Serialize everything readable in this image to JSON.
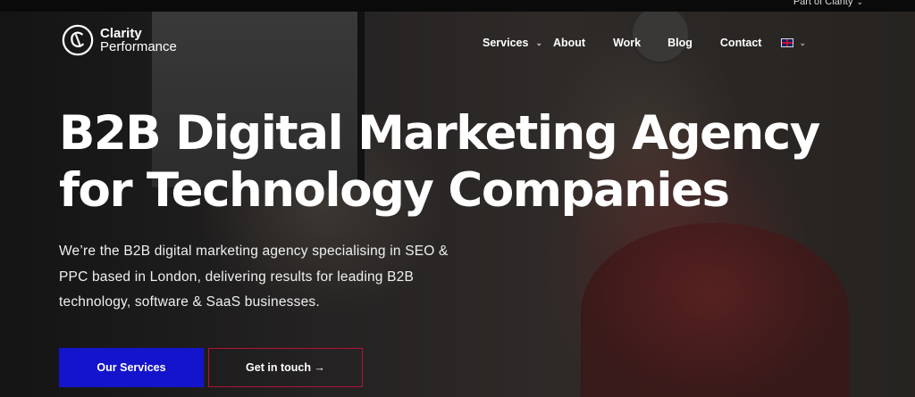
{
  "topbar": {
    "part_of": "Part of Clarity"
  },
  "logo": {
    "line1": "Clarity",
    "line2": "Performance"
  },
  "nav": {
    "items": [
      "Services",
      "About",
      "Work",
      "Blog",
      "Contact"
    ],
    "language": "English"
  },
  "hero": {
    "title_line1": "B2B Digital Marketing Agency",
    "title_line2": "for Technology Companies",
    "subtitle_line1": "We’re the B2B digital marketing agency specialising in SEO &",
    "subtitle_line2": "PPC based in London, delivering results for leading B2B",
    "subtitle_line3": "technology, software & SaaS businesses.",
    "cta_primary": "Our Services",
    "cta_secondary": "Get in touch →"
  },
  "colors": {
    "primary_button": "#1414cc",
    "secondary_border": "#b3123a"
  }
}
